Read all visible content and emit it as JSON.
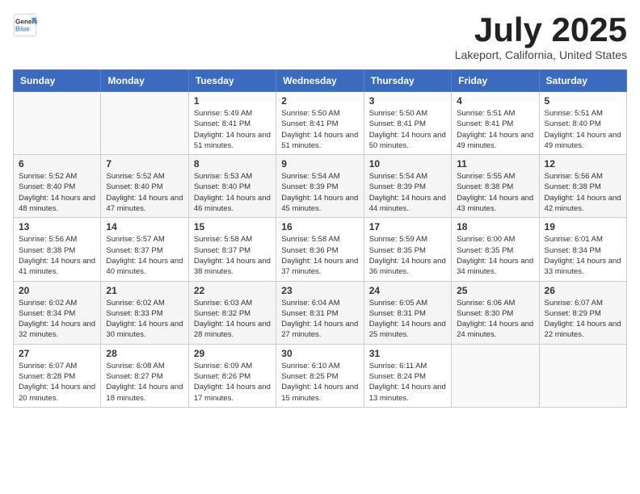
{
  "header": {
    "logo_line1": "General",
    "logo_line2": "Blue",
    "month_title": "July 2025",
    "location": "Lakeport, California, United States"
  },
  "weekdays": [
    "Sunday",
    "Monday",
    "Tuesday",
    "Wednesday",
    "Thursday",
    "Friday",
    "Saturday"
  ],
  "weeks": [
    [
      {
        "day": "",
        "sunrise": "",
        "sunset": "",
        "daylight": ""
      },
      {
        "day": "",
        "sunrise": "",
        "sunset": "",
        "daylight": ""
      },
      {
        "day": "1",
        "sunrise": "Sunrise: 5:49 AM",
        "sunset": "Sunset: 8:41 PM",
        "daylight": "Daylight: 14 hours and 51 minutes."
      },
      {
        "day": "2",
        "sunrise": "Sunrise: 5:50 AM",
        "sunset": "Sunset: 8:41 PM",
        "daylight": "Daylight: 14 hours and 51 minutes."
      },
      {
        "day": "3",
        "sunrise": "Sunrise: 5:50 AM",
        "sunset": "Sunset: 8:41 PM",
        "daylight": "Daylight: 14 hours and 50 minutes."
      },
      {
        "day": "4",
        "sunrise": "Sunrise: 5:51 AM",
        "sunset": "Sunset: 8:41 PM",
        "daylight": "Daylight: 14 hours and 49 minutes."
      },
      {
        "day": "5",
        "sunrise": "Sunrise: 5:51 AM",
        "sunset": "Sunset: 8:40 PM",
        "daylight": "Daylight: 14 hours and 49 minutes."
      }
    ],
    [
      {
        "day": "6",
        "sunrise": "Sunrise: 5:52 AM",
        "sunset": "Sunset: 8:40 PM",
        "daylight": "Daylight: 14 hours and 48 minutes."
      },
      {
        "day": "7",
        "sunrise": "Sunrise: 5:52 AM",
        "sunset": "Sunset: 8:40 PM",
        "daylight": "Daylight: 14 hours and 47 minutes."
      },
      {
        "day": "8",
        "sunrise": "Sunrise: 5:53 AM",
        "sunset": "Sunset: 8:40 PM",
        "daylight": "Daylight: 14 hours and 46 minutes."
      },
      {
        "day": "9",
        "sunrise": "Sunrise: 5:54 AM",
        "sunset": "Sunset: 8:39 PM",
        "daylight": "Daylight: 14 hours and 45 minutes."
      },
      {
        "day": "10",
        "sunrise": "Sunrise: 5:54 AM",
        "sunset": "Sunset: 8:39 PM",
        "daylight": "Daylight: 14 hours and 44 minutes."
      },
      {
        "day": "11",
        "sunrise": "Sunrise: 5:55 AM",
        "sunset": "Sunset: 8:38 PM",
        "daylight": "Daylight: 14 hours and 43 minutes."
      },
      {
        "day": "12",
        "sunrise": "Sunrise: 5:56 AM",
        "sunset": "Sunset: 8:38 PM",
        "daylight": "Daylight: 14 hours and 42 minutes."
      }
    ],
    [
      {
        "day": "13",
        "sunrise": "Sunrise: 5:56 AM",
        "sunset": "Sunset: 8:38 PM",
        "daylight": "Daylight: 14 hours and 41 minutes."
      },
      {
        "day": "14",
        "sunrise": "Sunrise: 5:57 AM",
        "sunset": "Sunset: 8:37 PM",
        "daylight": "Daylight: 14 hours and 40 minutes."
      },
      {
        "day": "15",
        "sunrise": "Sunrise: 5:58 AM",
        "sunset": "Sunset: 8:37 PM",
        "daylight": "Daylight: 14 hours and 38 minutes."
      },
      {
        "day": "16",
        "sunrise": "Sunrise: 5:58 AM",
        "sunset": "Sunset: 8:36 PM",
        "daylight": "Daylight: 14 hours and 37 minutes."
      },
      {
        "day": "17",
        "sunrise": "Sunrise: 5:59 AM",
        "sunset": "Sunset: 8:35 PM",
        "daylight": "Daylight: 14 hours and 36 minutes."
      },
      {
        "day": "18",
        "sunrise": "Sunrise: 6:00 AM",
        "sunset": "Sunset: 8:35 PM",
        "daylight": "Daylight: 14 hours and 34 minutes."
      },
      {
        "day": "19",
        "sunrise": "Sunrise: 6:01 AM",
        "sunset": "Sunset: 8:34 PM",
        "daylight": "Daylight: 14 hours and 33 minutes."
      }
    ],
    [
      {
        "day": "20",
        "sunrise": "Sunrise: 6:02 AM",
        "sunset": "Sunset: 8:34 PM",
        "daylight": "Daylight: 14 hours and 32 minutes."
      },
      {
        "day": "21",
        "sunrise": "Sunrise: 6:02 AM",
        "sunset": "Sunset: 8:33 PM",
        "daylight": "Daylight: 14 hours and 30 minutes."
      },
      {
        "day": "22",
        "sunrise": "Sunrise: 6:03 AM",
        "sunset": "Sunset: 8:32 PM",
        "daylight": "Daylight: 14 hours and 28 minutes."
      },
      {
        "day": "23",
        "sunrise": "Sunrise: 6:04 AM",
        "sunset": "Sunset: 8:31 PM",
        "daylight": "Daylight: 14 hours and 27 minutes."
      },
      {
        "day": "24",
        "sunrise": "Sunrise: 6:05 AM",
        "sunset": "Sunset: 8:31 PM",
        "daylight": "Daylight: 14 hours and 25 minutes."
      },
      {
        "day": "25",
        "sunrise": "Sunrise: 6:06 AM",
        "sunset": "Sunset: 8:30 PM",
        "daylight": "Daylight: 14 hours and 24 minutes."
      },
      {
        "day": "26",
        "sunrise": "Sunrise: 6:07 AM",
        "sunset": "Sunset: 8:29 PM",
        "daylight": "Daylight: 14 hours and 22 minutes."
      }
    ],
    [
      {
        "day": "27",
        "sunrise": "Sunrise: 6:07 AM",
        "sunset": "Sunset: 8:28 PM",
        "daylight": "Daylight: 14 hours and 20 minutes."
      },
      {
        "day": "28",
        "sunrise": "Sunrise: 6:08 AM",
        "sunset": "Sunset: 8:27 PM",
        "daylight": "Daylight: 14 hours and 18 minutes."
      },
      {
        "day": "29",
        "sunrise": "Sunrise: 6:09 AM",
        "sunset": "Sunset: 8:26 PM",
        "daylight": "Daylight: 14 hours and 17 minutes."
      },
      {
        "day": "30",
        "sunrise": "Sunrise: 6:10 AM",
        "sunset": "Sunset: 8:25 PM",
        "daylight": "Daylight: 14 hours and 15 minutes."
      },
      {
        "day": "31",
        "sunrise": "Sunrise: 6:11 AM",
        "sunset": "Sunset: 8:24 PM",
        "daylight": "Daylight: 14 hours and 13 minutes."
      },
      {
        "day": "",
        "sunrise": "",
        "sunset": "",
        "daylight": ""
      },
      {
        "day": "",
        "sunrise": "",
        "sunset": "",
        "daylight": ""
      }
    ]
  ]
}
